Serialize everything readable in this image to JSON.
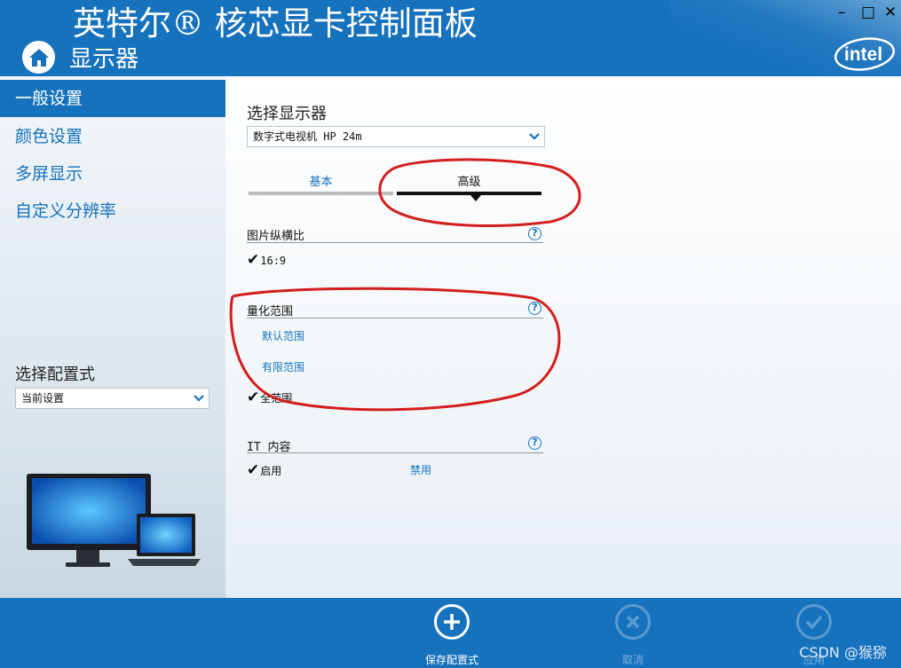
{
  "header": {
    "app_title": "英特尔® 核芯显卡控制面板",
    "section_title": "显示器",
    "window_controls": {
      "minimize": "–",
      "maximize": "□",
      "close": "✕"
    },
    "logo_text": "intel"
  },
  "sidebar": {
    "items": [
      {
        "label": "一般设置",
        "active": true
      },
      {
        "label": "颜色设置",
        "active": false
      },
      {
        "label": "多屏显示",
        "active": false
      },
      {
        "label": "自定义分辨率",
        "active": false
      }
    ],
    "profile_label": "选择配置式",
    "profile_value": "当前设置"
  },
  "main": {
    "select_display_label": "选择显示器",
    "display_value": "数字式电视机 HP 24m",
    "tabs": {
      "basic": "基本",
      "advanced": "高级",
      "selected": "advanced"
    },
    "aspect_ratio": {
      "title": "图片纵横比",
      "value": "16:9",
      "help": "?"
    },
    "quantization_range": {
      "title": "量化范围",
      "help": "?",
      "options": [
        "默认范围",
        "有限范围",
        "全范围"
      ],
      "selected": "全范围"
    },
    "it_content": {
      "title": "IT 内容",
      "help": "?",
      "enable": "启用",
      "disable": "禁用",
      "selected": "启用"
    }
  },
  "footer": {
    "save_profile": "保存配置式",
    "cancel": "取消",
    "apply": "应用",
    "watermark": "CSDN @猴猕"
  },
  "colors": {
    "brand_blue": "#1772bd",
    "annotation_red": "#d41d1d"
  }
}
